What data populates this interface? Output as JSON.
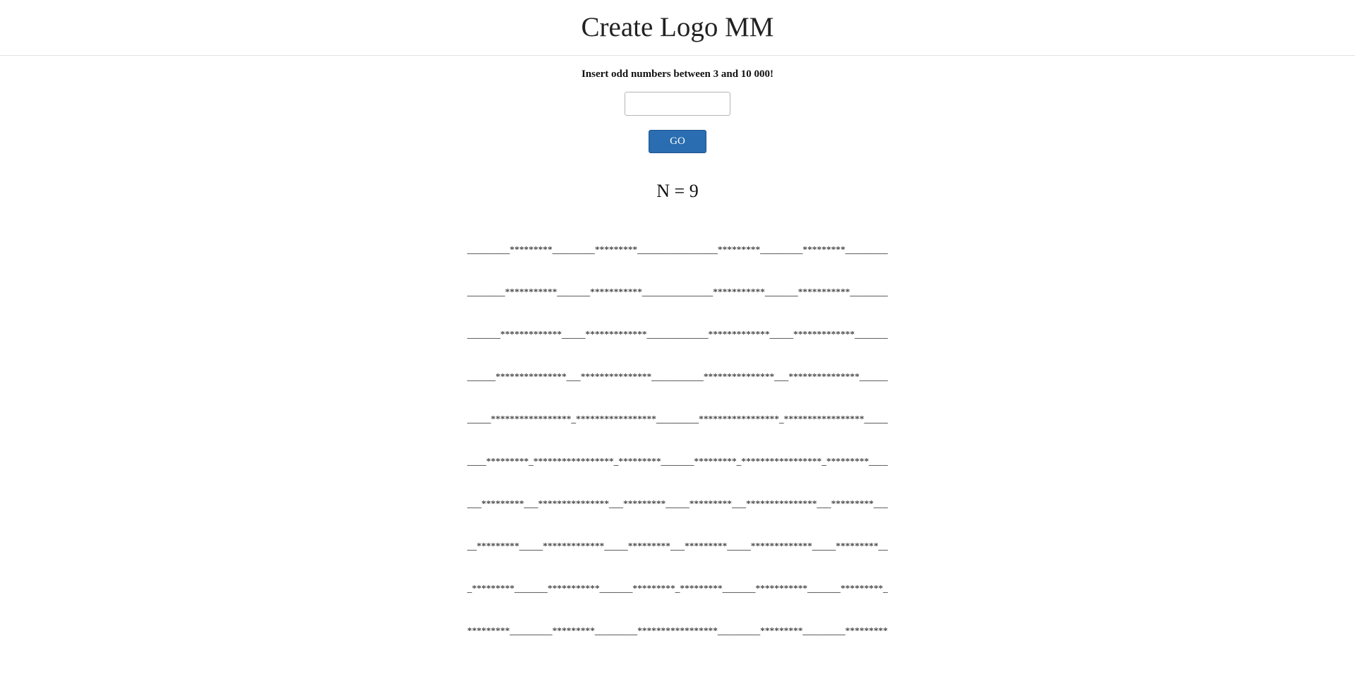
{
  "header": {
    "title": "Create Logo MM"
  },
  "form": {
    "instruction": "Insert odd numbers between 3 and 10 000!",
    "input_value": "",
    "input_placeholder": "",
    "go_label": "GO"
  },
  "result": {
    "n_label": "N = 9",
    "logo_lines": [
      "_________*********_________*********_________________*********_________*********_________",
      "________***********_______***********_______________***********_______***********________",
      "_______*************_____*************_____________*************_____*************_______",
      "______***************___***************___________***************___***************______",
      "_____*****************_*****************_________*****************_*****************_____",
      "____*********_*****************_*********_______*********_*****************_*********____",
      "___*********___***************___*********_____*********___***************___*********___",
      "__*********_____*************_____*********___*********_____*************_____*********__",
      "_*********_______***********_______*********_*********_______***********_______*********_",
      "*********_________*********_________*****************_________*********_________*********"
    ]
  }
}
